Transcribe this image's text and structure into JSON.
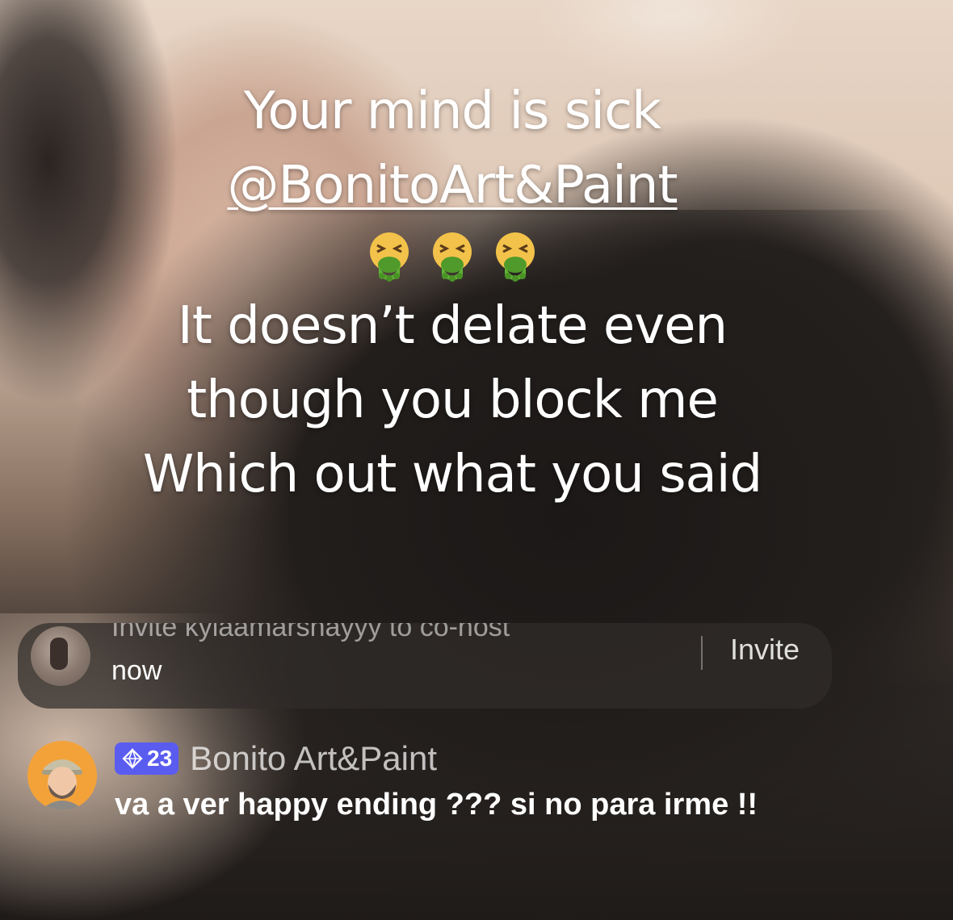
{
  "caption": {
    "line1": "Your mind is sick",
    "mention": "@BonitoArt&Paint",
    "emojis": [
      "vomiting-face",
      "vomiting-face",
      "vomiting-face"
    ],
    "line3": "It doesn’t delate even",
    "line4": "though you block me",
    "line5": "Which out what you said"
  },
  "invite_banner": {
    "title": "Invite kylaamarshayyy to co-host",
    "time": "now",
    "button_label": "Invite"
  },
  "comment": {
    "badge_level": "23",
    "username": "Bonito Art&Paint",
    "text": "va a ver happy ending ??? si no para irme !!"
  },
  "colors": {
    "badge": "#5a5cf0",
    "avatar_bg": "#f3a23a",
    "banner_bg": "#302c2a"
  }
}
